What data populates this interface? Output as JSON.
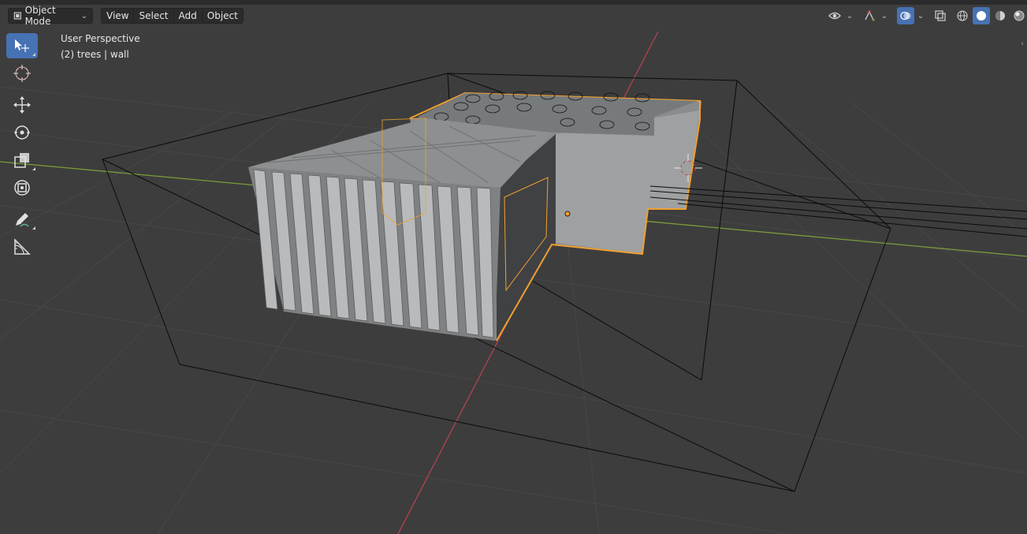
{
  "header": {
    "mode_label": "Object Mode",
    "menus": [
      "View",
      "Select",
      "Add",
      "Object"
    ],
    "right_icons": [
      "visibility-eye-icon",
      "gizmo-icon",
      "overlay-icon",
      "xray-icon",
      "wireframe-shading-icon",
      "solid-shading-icon",
      "material-shading-icon",
      "rendered-shading-icon"
    ]
  },
  "viewport": {
    "view_name": "User Perspective",
    "selection_info": "(2) trees | wall"
  },
  "toolbar": {
    "tools": [
      "select-box-icon",
      "cursor-icon",
      "move-icon",
      "rotate-icon",
      "scale-icon",
      "transform-icon",
      "annotate-icon",
      "measure-icon"
    ],
    "active_tool": "select-box-icon"
  },
  "colors": {
    "background": "#3d3d3d",
    "header_button": "#2b2b2b",
    "active_blue": "#4772b3",
    "selection_orange": "#f0a030",
    "x_axis": "#b04450",
    "y_axis": "#7a9a3a"
  }
}
